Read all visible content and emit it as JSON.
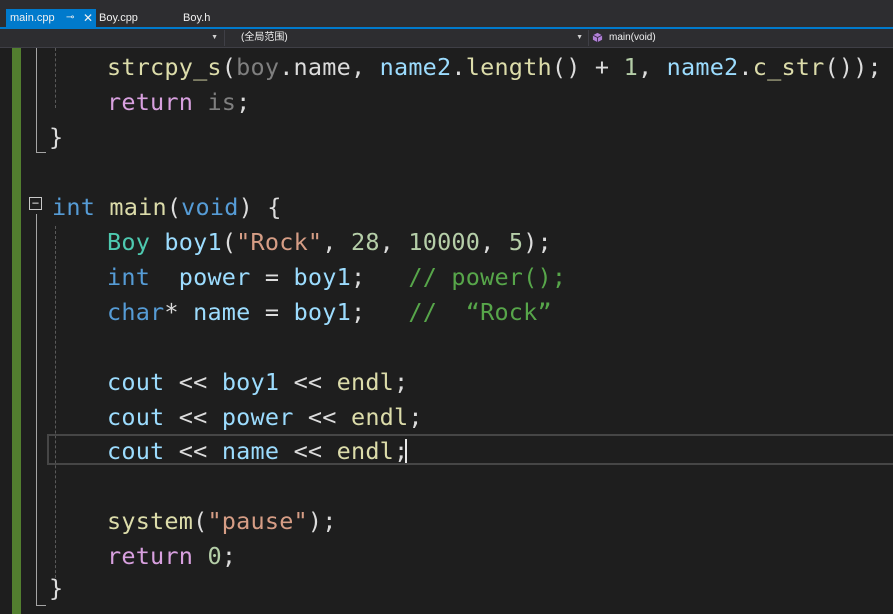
{
  "tabs": [
    {
      "label": "main.cpp",
      "active": true,
      "pin_glyph": "⊸",
      "close_glyph": "✕"
    },
    {
      "label": "Boy.cpp",
      "active": false
    },
    {
      "label": "Boy.h",
      "active": false
    }
  ],
  "navbar": {
    "project": "",
    "scope": "(全局范围)",
    "member": "main(void)"
  },
  "colors": {
    "accent": "#007acc",
    "keyword": "#569cd6",
    "type": "#4ec9b0",
    "function": "#dcdcaa",
    "variable": "#9cdcfe",
    "string": "#d69d85",
    "number": "#b5cea8",
    "comment": "#57a64a",
    "control": "#d8a0df",
    "change_margin": "#527e2f"
  },
  "icons": {
    "collapse": "minus-box-icon",
    "member": "method-cube-icon",
    "dropdown": "triangle-down-icon"
  },
  "code": {
    "line1": {
      "fn": "strcpy_s",
      "p1": "(",
      "dim1": "boy",
      "p2": ".name, ",
      "v1": "name2",
      "p3": ".",
      "f2": "length",
      "p4": "() + ",
      "n1": "1",
      "p5": ", ",
      "v2": "name2",
      "p6": ".",
      "f3": "c_str",
      "p7": "());"
    },
    "line2": {
      "kw": "return",
      "sp": " ",
      "dim": "is",
      "p": ";"
    },
    "line3": {
      "brace": "}"
    },
    "line4": {
      "kw1": "int",
      "sp": " ",
      "fn": "main",
      "p1": "(",
      "kw2": "void",
      "p2": ") {"
    },
    "line5": {
      "ty": "Boy",
      "sp": " ",
      "v": "boy1",
      "p1": "(",
      "s": "\"Rock\"",
      "p2": ", ",
      "n1": "28",
      "p3": ", ",
      "n2": "10000",
      "p4": ", ",
      "n3": "5",
      "p5": ");"
    },
    "line6": {
      "kw": "int",
      "sp": "  ",
      "v": "power",
      "p1": " = ",
      "v2": "boy1",
      "p2": ";   ",
      "cm": "// power();"
    },
    "line7": {
      "kw": "char",
      "p0": "* ",
      "v": "name",
      "p1": " = ",
      "v2": "boy1",
      "p2": ";   ",
      "cm": "//  “Rock”"
    },
    "line8": {
      "v1": "cout",
      "p1": " << ",
      "v2": "boy1",
      "p2": " << ",
      "f": "endl",
      "p3": ";"
    },
    "line9": {
      "v1": "cout",
      "p1": " << ",
      "v2": "power",
      "p2": " << ",
      "f": "endl",
      "p3": ";"
    },
    "line10": {
      "v1": "cout",
      "p1": " << ",
      "v2": "name",
      "p2": " << ",
      "f": "endl",
      "p3": ";"
    },
    "line11": {
      "fn": "system",
      "p1": "(",
      "s": "\"pause\"",
      "p2": ");"
    },
    "line12": {
      "kw": "return",
      "sp": " ",
      "n": "0",
      "p": ";"
    },
    "line13": {
      "brace": "}"
    }
  }
}
